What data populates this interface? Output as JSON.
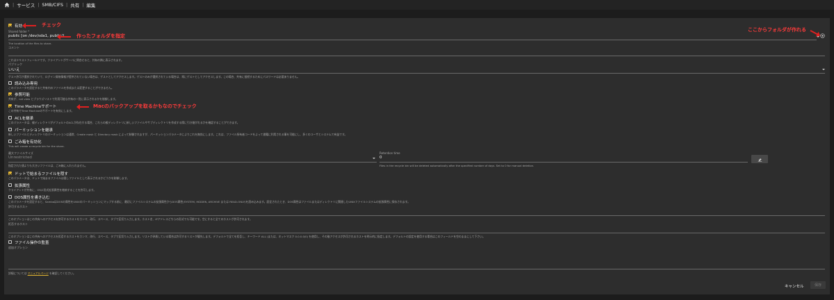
{
  "breadcrumb": {
    "items": [
      "サービス",
      "SMB/CIFS",
      "共有",
      "編集"
    ],
    "separator": "|"
  },
  "form": {
    "enabled": {
      "label": "有効",
      "checked": true
    },
    "shared_folder": {
      "label": "Shared folder *",
      "value": "public [on /dev/sda1, public/]",
      "help": "The location of the files to share."
    },
    "comment": {
      "label": "コメント",
      "help": "これはテキストフィールドです。クライアントがサーバに問合せると、共有の隣に表示されます。"
    },
    "public": {
      "label": "パブリック",
      "value": "いいえ",
      "help": "ゲスト許可が選択されていて、ログイン資格情報が提供されていない場合は、ゲストとしてアクセスします。ゲストのみが選択されている場合は、常にゲストとしてアクセスします。この場合、共有に接続するためにパスワードは必要ありません。"
    },
    "readonly": {
      "label": "読み込み専用",
      "checked": false,
      "help": "このパラメータを設定すると共有内のファイルを作成または変更することができません。"
    },
    "browseable": {
      "label": "参照可能",
      "checked": true,
      "help": "共有が、net view とブラウズリストで利用可能な共有の一覧に表示されるかを制御します。"
    },
    "timemachine": {
      "label": "Time Machineサポート",
      "checked": true,
      "help": "この共有でTime Machineのサポートを有効にします。"
    },
    "inherit_acls": {
      "label": "ACLを継承",
      "checked": false,
      "help": "このパラメータは、親ディレクトリがデフォルトのACLが存在する場合、これらの親ディレクトリに新しいファイルやサブディレクトリを作成する際に引き継がれるかを確認することができます。"
    },
    "inherit_perms": {
      "label": "パーミッションを継承",
      "checked": false,
      "help": "新しいファイルとディレクトリのパーミッションは通常、Create mask と Directory mask によって制御されますが、パーミッションパラメータによりこれを無効にします。これは、ファイル所有者コードをよって書籍に利用される事を可能にし、多くのユーザとシステムで有益です。"
    },
    "recycle": {
      "label": "ごみ箱を有効化",
      "checked": false,
      "help": "This will create a recycle bin for the share."
    },
    "max_file_size": {
      "label": "最大ファイルサイズ",
      "value": "Unrestricted",
      "help": "指定された値よりも大きいファイルは、ごみ箱に入れられません。"
    },
    "retention": {
      "label": "Retention time",
      "value": "0",
      "help": "Files in the recycle bin will be deleted automatically after the specified number of days. Set to 0 for manual deletion."
    },
    "hide_dot": {
      "label": "ドットで始まるファイルを隠す",
      "checked": true,
      "help": "このパラメータは、ドットで始まるファイルは隠しファイルとして表示されるかどうかを制御します。"
    },
    "ext_attrs": {
      "label": "拡張属性",
      "checked": false,
      "help": "クライアントが共有に、OS/2形式拡張属性を格納することを許可します。"
    },
    "dos_attrs": {
      "label": "DOS属性を書き込む",
      "checked": false,
      "help": "このパラメータを設定すると、SambaはDOSの属性をUNIXのパーミッションにマップする前に、最初にファイルシステムの拡張属性からDOS属性(SYSTEM, HIDDEN, ARCHIVE または READ-ONLY)を読み込みます。設定されたとき、DOS属性はファイルまたはディレクトリに関連したUNIXファイルシステムの拡張属性に保存されます。"
    },
    "hosts_allow": {
      "label": "許可するホスト",
      "help": "このオプションはこの共有へのアクセスを許可するホストをカンマ、改行、スペース、タブで区切り入力します。ホスト名、IPアドレスどちらの形式でも可能です。空にすると全てのホストが許可されます。"
    },
    "hosts_deny": {
      "label": "拒否するホスト",
      "help": "このオプションはこの共有へのアクセスを拒否するホストをカンマ、改行、スペース、タブで区切り入力します。リストが矛盾している場合は許可するリストが優先します。デフォルトで全てを拒否し、キーワード ALL (または、ネットマスク 0.0.0.0/0) を使用し、その後アクセスが許可されるホストを明示的に指定します。デフォルトの設定を使用する場合はこのフィールドを空のままにして下さい。"
    },
    "audit": {
      "label": "ファイル操作の監査",
      "checked": false
    },
    "extra": {
      "label": "追加オプション",
      "help_prefix": "詳細については",
      "help_link": "マニュアルページ",
      "help_suffix": "を確認してください。"
    }
  },
  "buttons": {
    "cancel": "キャンセル",
    "save": "保存"
  },
  "annotations": {
    "check": "チェック",
    "folder": "作ったフォルダを指定",
    "timemachine": "Macのバックアップを取るかもなのでチェック",
    "create_folder": "ここからフォルダが作れる"
  },
  "colors": {
    "accent": "#e6b833",
    "annotation": "#ff3b3b",
    "panel": "#2d2d2d",
    "background": "#1c1c1c"
  },
  "icons": {
    "home": "home-icon",
    "add": "add-circle-icon",
    "dropdown": "chevron-down-icon",
    "clear": "eraser-icon"
  }
}
